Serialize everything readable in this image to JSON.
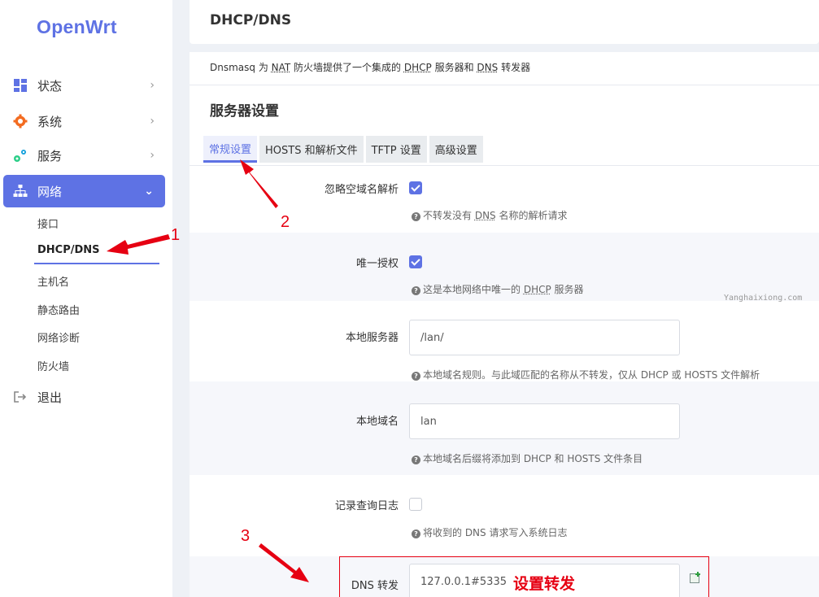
{
  "sidebar": {
    "logo": "OpenWrt",
    "menu": [
      {
        "label": "状态",
        "icon": "dashboard-icon"
      },
      {
        "label": "系统",
        "icon": "gear-icon"
      },
      {
        "label": "服务",
        "icon": "services-icon"
      },
      {
        "label": "网络",
        "icon": "network-icon"
      },
      {
        "label": "退出",
        "icon": "logout-icon"
      }
    ],
    "network_submenu": [
      "接口",
      "DHCP/DNS",
      "主机名",
      "静态路由",
      "网络诊断",
      "防火墙"
    ],
    "arrow_right": "›",
    "arrow_down": "⌄"
  },
  "header": {
    "title": "DHCP/DNS"
  },
  "description": {
    "p1": "Dnsmasq 为 ",
    "a1": "NAT",
    "p2": " 防火墙提供了一个集成的 ",
    "a2": "DHCP",
    "p3": " 服务器和 ",
    "a3": "DNS",
    "p4": " 转发器"
  },
  "section_title": "服务器设置",
  "tabs": [
    "常规设置",
    "HOSTS 和解析文件",
    "TFTP 设置",
    "高级设置"
  ],
  "fields": {
    "ignore_empty": {
      "label": "忽略空域名解析",
      "checked": true,
      "hint_a": "不转发没有 ",
      "hint_abbr": "DNS",
      "hint_b": " 名称的解析请求"
    },
    "authoritative": {
      "label": "唯一授权",
      "checked": true,
      "hint_a": "这是本地网络中唯一的 ",
      "hint_abbr": "DHCP",
      "hint_b": " 服务器"
    },
    "local_server": {
      "label": "本地服务器",
      "value": "/lan/",
      "hint": "本地域名规则。与此域匹配的名称从不转发，仅从 DHCP 或 HOSTS 文件解析"
    },
    "local_domain": {
      "label": "本地域名",
      "value": "lan",
      "hint": "本地域名后缀将添加到 DHCP 和 HOSTS 文件条目"
    },
    "log_queries": {
      "label": "记录查询日志",
      "checked": false,
      "hint": "将收到的 DNS 请求写入系统日志"
    },
    "dns_forward": {
      "label": "DNS 转发",
      "value": "127.0.0.1#5335"
    }
  },
  "watermark": "Yanghaixiong.com",
  "annotations": {
    "n1": "1",
    "n2": "2",
    "n3": "3",
    "forward_note": "设置转发",
    "color": "#e60012"
  },
  "colors": {
    "accent": "#5e72e4"
  }
}
